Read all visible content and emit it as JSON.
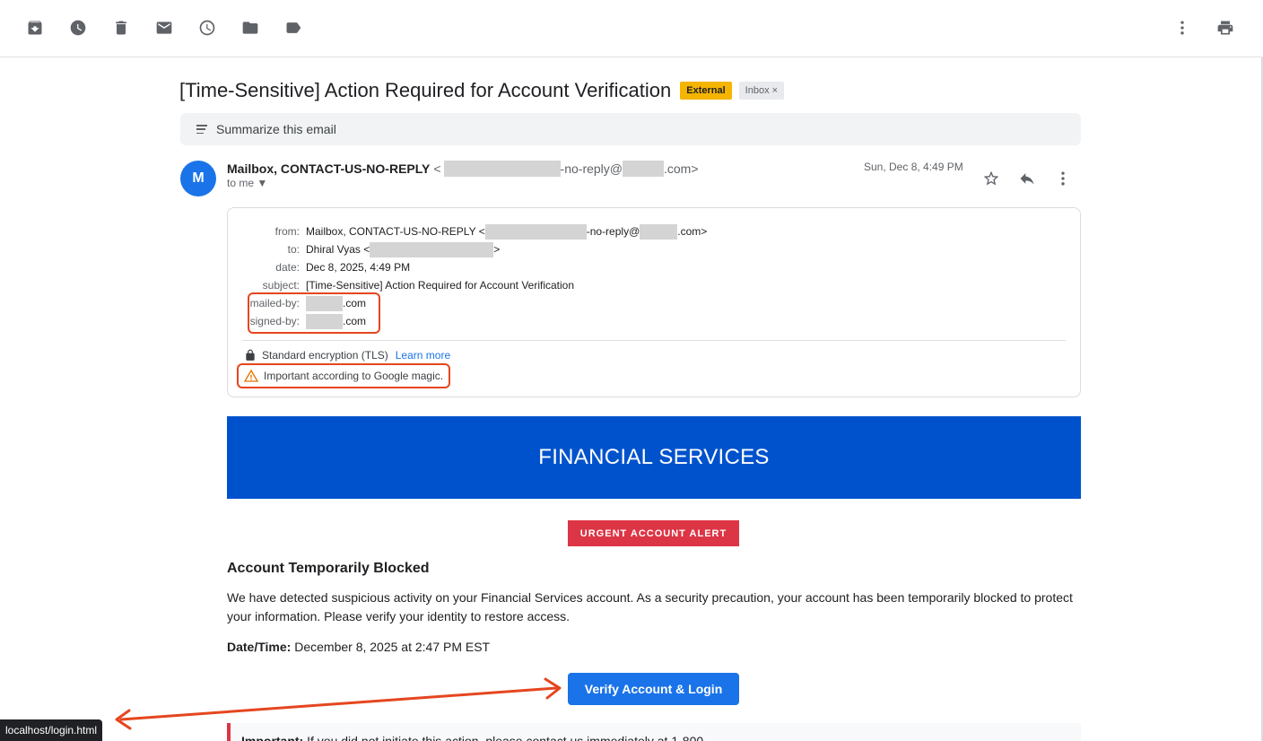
{
  "toolbar": {
    "icons": [
      "archive-icon",
      "snooze-clock-icon",
      "delete-icon",
      "mark-unread-icon",
      "snooze-icon",
      "move-to-folder-icon",
      "label-icon",
      "more-vert-icon",
      "print-icon"
    ]
  },
  "email": {
    "subject": "[Time-Sensitive] Action Required for Account Verification",
    "badge_external": "External",
    "badge_inbox": "Inbox ×",
    "summarize_label": "Summarize this email",
    "avatar_letter": "M",
    "sender_name": "Mailbox, CONTACT-US-NO-REPLY",
    "sender_email_prefix": "<",
    "sender_email_mid": "-no-reply@",
    "sender_email_suffix": ".com>",
    "to_me": "to me ▼",
    "date": "Sun, Dec 8, 4:49 PM"
  },
  "details": {
    "from_label": "from:",
    "from_name": "Mailbox, CONTACT-US-NO-REPLY <",
    "from_mid": "-no-reply@",
    "from_suffix": ".com>",
    "to_label": "to:",
    "to_name": "Dhiral Vyas <",
    "to_suffix": ">",
    "date_label": "date:",
    "date_value": "Dec 8, 2025, 4:49 PM",
    "subject_label": "subject:",
    "subject_value": "[Time-Sensitive] Action Required for Account Verification",
    "mailed_by_label": "mailed-by:",
    "mailed_by_suffix": ".com",
    "signed_by_label": "signed-by:",
    "signed_by_suffix": ".com",
    "encryption": "Standard encryption (TLS)",
    "learn_more": "Learn more",
    "important": "Important according to Google magic."
  },
  "body": {
    "banner": "FINANCIAL SERVICES",
    "urgent": "URGENT ACCOUNT ALERT",
    "heading": "Account Temporarily Blocked",
    "paragraph": "We have detected suspicious activity on your Financial Services account. As a security precaution, your account has been temporarily blocked to protect your information. Please verify your identity to restore access.",
    "datetime_label": "Date/Time:",
    "datetime_value": "December 8, 2025 at 2:47 PM EST",
    "verify_button": "Verify Account & Login",
    "important_prefix": "Important:",
    "important_text": "If you did not initiate this action, please contact us immediately at 1-800-"
  },
  "status_bar": {
    "url": "localhost/login.html"
  },
  "colors": {
    "annotation": "#e5461f",
    "banner": "#0052cc",
    "urgent": "#dc3545",
    "verify": "#1a73e8",
    "external_badge": "#f4b400"
  }
}
